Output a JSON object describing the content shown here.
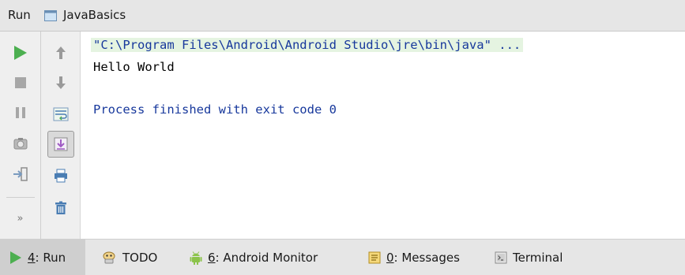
{
  "header": {
    "run_label": "Run",
    "config_name": "JavaBasics"
  },
  "toolbar_left": [
    {
      "icon": "run-icon",
      "tooltip": "Rerun"
    },
    {
      "icon": "stop-icon",
      "tooltip": "Stop"
    },
    {
      "icon": "pause-icon",
      "tooltip": "Pause"
    },
    {
      "icon": "camera-icon",
      "tooltip": "Dump threads"
    },
    {
      "icon": "exit-icon",
      "tooltip": "Close"
    },
    {
      "icon": "more-icon",
      "label": "»"
    }
  ],
  "toolbar_right": [
    {
      "icon": "arrow-up-icon"
    },
    {
      "icon": "arrow-down-icon"
    },
    {
      "icon": "soft-wrap-icon"
    },
    {
      "icon": "scroll-to-end-icon",
      "selected": true
    },
    {
      "icon": "print-icon"
    },
    {
      "icon": "trash-icon"
    }
  ],
  "console": {
    "command_line": "\"C:\\Program Files\\Android\\Android Studio\\jre\\bin\\java\" ...",
    "output_line": "Hello World",
    "exit_line": "Process finished with exit code 0"
  },
  "colors": {
    "console_blue": "#17389c",
    "run_green": "#4caf50"
  },
  "status_tabs": [
    {
      "number": "4",
      "rest": ": Run",
      "icon": "run-icon",
      "active": true
    },
    {
      "number": "",
      "rest": "TODO",
      "icon": "todo-icon",
      "active": false
    },
    {
      "number": "6",
      "rest": ": Android Monitor",
      "icon": "android-icon",
      "active": false
    },
    {
      "number": "0",
      "rest": ": Messages",
      "icon": "messages-icon",
      "active": false
    },
    {
      "number": "",
      "rest": "Terminal",
      "icon": "terminal-icon",
      "active": false
    }
  ]
}
